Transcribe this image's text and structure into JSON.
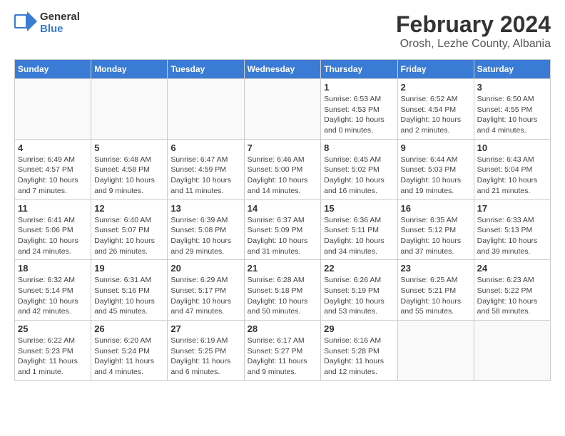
{
  "logo": {
    "general": "General",
    "blue": "Blue"
  },
  "header": {
    "month": "February 2024",
    "location": "Orosh, Lezhe County, Albania"
  },
  "weekdays": [
    "Sunday",
    "Monday",
    "Tuesday",
    "Wednesday",
    "Thursday",
    "Friday",
    "Saturday"
  ],
  "weeks": [
    [
      {
        "day": "",
        "info": ""
      },
      {
        "day": "",
        "info": ""
      },
      {
        "day": "",
        "info": ""
      },
      {
        "day": "",
        "info": ""
      },
      {
        "day": "1",
        "info": "Sunrise: 6:53 AM\nSunset: 4:53 PM\nDaylight: 10 hours and 0 minutes."
      },
      {
        "day": "2",
        "info": "Sunrise: 6:52 AM\nSunset: 4:54 PM\nDaylight: 10 hours and 2 minutes."
      },
      {
        "day": "3",
        "info": "Sunrise: 6:50 AM\nSunset: 4:55 PM\nDaylight: 10 hours and 4 minutes."
      }
    ],
    [
      {
        "day": "4",
        "info": "Sunrise: 6:49 AM\nSunset: 4:57 PM\nDaylight: 10 hours and 7 minutes."
      },
      {
        "day": "5",
        "info": "Sunrise: 6:48 AM\nSunset: 4:58 PM\nDaylight: 10 hours and 9 minutes."
      },
      {
        "day": "6",
        "info": "Sunrise: 6:47 AM\nSunset: 4:59 PM\nDaylight: 10 hours and 11 minutes."
      },
      {
        "day": "7",
        "info": "Sunrise: 6:46 AM\nSunset: 5:00 PM\nDaylight: 10 hours and 14 minutes."
      },
      {
        "day": "8",
        "info": "Sunrise: 6:45 AM\nSunset: 5:02 PM\nDaylight: 10 hours and 16 minutes."
      },
      {
        "day": "9",
        "info": "Sunrise: 6:44 AM\nSunset: 5:03 PM\nDaylight: 10 hours and 19 minutes."
      },
      {
        "day": "10",
        "info": "Sunrise: 6:43 AM\nSunset: 5:04 PM\nDaylight: 10 hours and 21 minutes."
      }
    ],
    [
      {
        "day": "11",
        "info": "Sunrise: 6:41 AM\nSunset: 5:06 PM\nDaylight: 10 hours and 24 minutes."
      },
      {
        "day": "12",
        "info": "Sunrise: 6:40 AM\nSunset: 5:07 PM\nDaylight: 10 hours and 26 minutes."
      },
      {
        "day": "13",
        "info": "Sunrise: 6:39 AM\nSunset: 5:08 PM\nDaylight: 10 hours and 29 minutes."
      },
      {
        "day": "14",
        "info": "Sunrise: 6:37 AM\nSunset: 5:09 PM\nDaylight: 10 hours and 31 minutes."
      },
      {
        "day": "15",
        "info": "Sunrise: 6:36 AM\nSunset: 5:11 PM\nDaylight: 10 hours and 34 minutes."
      },
      {
        "day": "16",
        "info": "Sunrise: 6:35 AM\nSunset: 5:12 PM\nDaylight: 10 hours and 37 minutes."
      },
      {
        "day": "17",
        "info": "Sunrise: 6:33 AM\nSunset: 5:13 PM\nDaylight: 10 hours and 39 minutes."
      }
    ],
    [
      {
        "day": "18",
        "info": "Sunrise: 6:32 AM\nSunset: 5:14 PM\nDaylight: 10 hours and 42 minutes."
      },
      {
        "day": "19",
        "info": "Sunrise: 6:31 AM\nSunset: 5:16 PM\nDaylight: 10 hours and 45 minutes."
      },
      {
        "day": "20",
        "info": "Sunrise: 6:29 AM\nSunset: 5:17 PM\nDaylight: 10 hours and 47 minutes."
      },
      {
        "day": "21",
        "info": "Sunrise: 6:28 AM\nSunset: 5:18 PM\nDaylight: 10 hours and 50 minutes."
      },
      {
        "day": "22",
        "info": "Sunrise: 6:26 AM\nSunset: 5:19 PM\nDaylight: 10 hours and 53 minutes."
      },
      {
        "day": "23",
        "info": "Sunrise: 6:25 AM\nSunset: 5:21 PM\nDaylight: 10 hours and 55 minutes."
      },
      {
        "day": "24",
        "info": "Sunrise: 6:23 AM\nSunset: 5:22 PM\nDaylight: 10 hours and 58 minutes."
      }
    ],
    [
      {
        "day": "25",
        "info": "Sunrise: 6:22 AM\nSunset: 5:23 PM\nDaylight: 11 hours and 1 minute."
      },
      {
        "day": "26",
        "info": "Sunrise: 6:20 AM\nSunset: 5:24 PM\nDaylight: 11 hours and 4 minutes."
      },
      {
        "day": "27",
        "info": "Sunrise: 6:19 AM\nSunset: 5:25 PM\nDaylight: 11 hours and 6 minutes."
      },
      {
        "day": "28",
        "info": "Sunrise: 6:17 AM\nSunset: 5:27 PM\nDaylight: 11 hours and 9 minutes."
      },
      {
        "day": "29",
        "info": "Sunrise: 6:16 AM\nSunset: 5:28 PM\nDaylight: 11 hours and 12 minutes."
      },
      {
        "day": "",
        "info": ""
      },
      {
        "day": "",
        "info": ""
      }
    ]
  ]
}
